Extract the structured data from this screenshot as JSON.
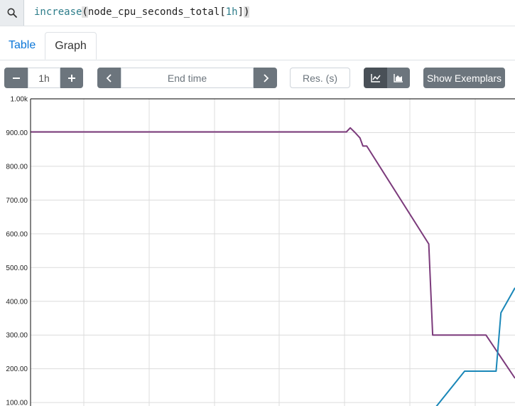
{
  "expression": {
    "function_name": "increase",
    "open_paren": "(",
    "metric": "node_cpu_seconds_total",
    "open_bracket": "[",
    "range": "1h",
    "close_bracket": "]",
    "close_paren": ")",
    "search_icon": "search-icon"
  },
  "tabs": [
    {
      "label": "Table",
      "active": false
    },
    {
      "label": "Graph",
      "active": true
    }
  ],
  "controls": {
    "range_value": "1h",
    "end_time_placeholder": "End time",
    "resolution_placeholder": "Res. (s)",
    "show_exemplars_label": "Show Exemplars",
    "icons": [
      "minus-icon",
      "plus-icon",
      "chevron-left-icon",
      "chevron-right-icon",
      "line-chart-icon",
      "stacked-area-chart-icon"
    ]
  },
  "chart_data": {
    "type": "line",
    "y_ticks": [
      "100.00",
      "200.00",
      "300.00",
      "400.00",
      "500.00",
      "600.00",
      "700.00",
      "800.00",
      "900.00",
      "1.00k"
    ],
    "ylim": [
      75,
      1000
    ],
    "xlim": [
      0,
      100
    ],
    "grid": true,
    "series": [
      {
        "color": "#7b3a7b",
        "x": [
          0,
          65.2,
          66,
          67,
          68,
          68.6,
          69.4,
          82.2,
          83,
          94,
          100
        ],
        "y": [
          902,
          902,
          914,
          900,
          884,
          860,
          860,
          570,
          300,
          300,
          172
        ]
      },
      {
        "color": "#1a87b8",
        "x": [
          83,
          89.6,
          96.1,
          97.1,
          100
        ],
        "y": [
          75,
          193,
          193,
          366,
          440
        ]
      }
    ]
  }
}
